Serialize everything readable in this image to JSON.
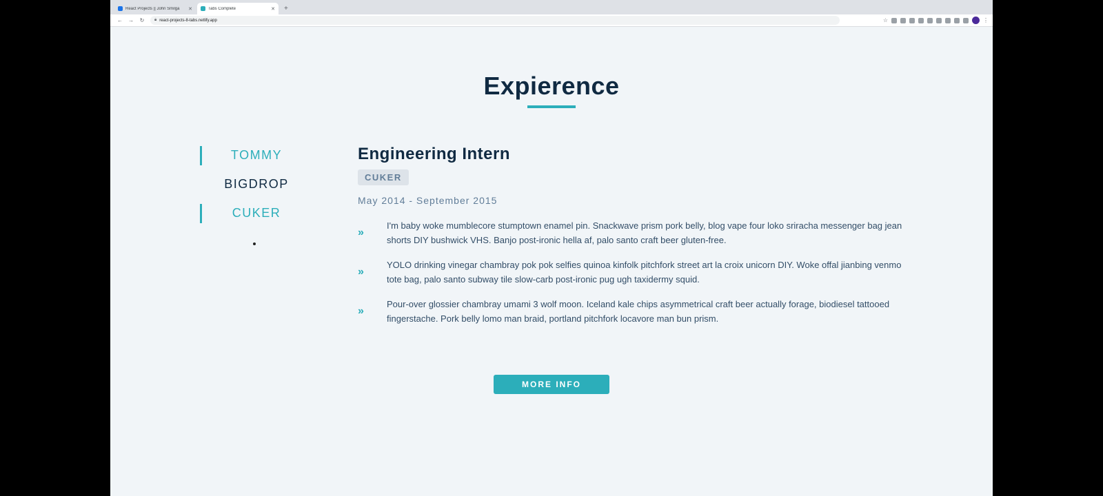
{
  "browser": {
    "tabs": [
      {
        "label": "React Projects || John Smilga",
        "favicon_color": "#1a73e8",
        "active": false
      },
      {
        "label": "Tabs Complete",
        "favicon_color": "#2caeba",
        "active": true
      }
    ],
    "new_tab": "+",
    "url": "react-projects-8-tabs.netlify.app"
  },
  "page": {
    "title": "Expierence",
    "accent_color": "#2caeba"
  },
  "companies": [
    {
      "label": "TOMMY",
      "active": true
    },
    {
      "label": "BIGDROP",
      "active": false
    },
    {
      "label": "CUKER",
      "active": true
    }
  ],
  "job": {
    "title": "Engineering Intern",
    "company": "CUKER",
    "dates": "May 2014 - September 2015",
    "duties": [
      "I'm baby woke mumblecore stumptown enamel pin. Snackwave prism pork belly, blog vape four loko sriracha messenger bag jean shorts DIY bushwick VHS. Banjo post-ironic hella af, palo santo craft beer gluten-free.",
      "YOLO drinking vinegar chambray pok pok selfies quinoa kinfolk pitchfork street art la croix unicorn DIY. Woke offal jianbing venmo tote bag, palo santo subway tile slow-carb post-ironic pug ugh taxidermy squid.",
      "Pour-over glossier chambray umami 3 wolf moon. Iceland kale chips asymmetrical craft beer actually forage, biodiesel tattooed fingerstache. Pork belly lomo man braid, portland pitchfork locavore man bun prism."
    ],
    "duty_icon": "double-chevron-right-icon"
  },
  "more_button": "MORE INFO"
}
